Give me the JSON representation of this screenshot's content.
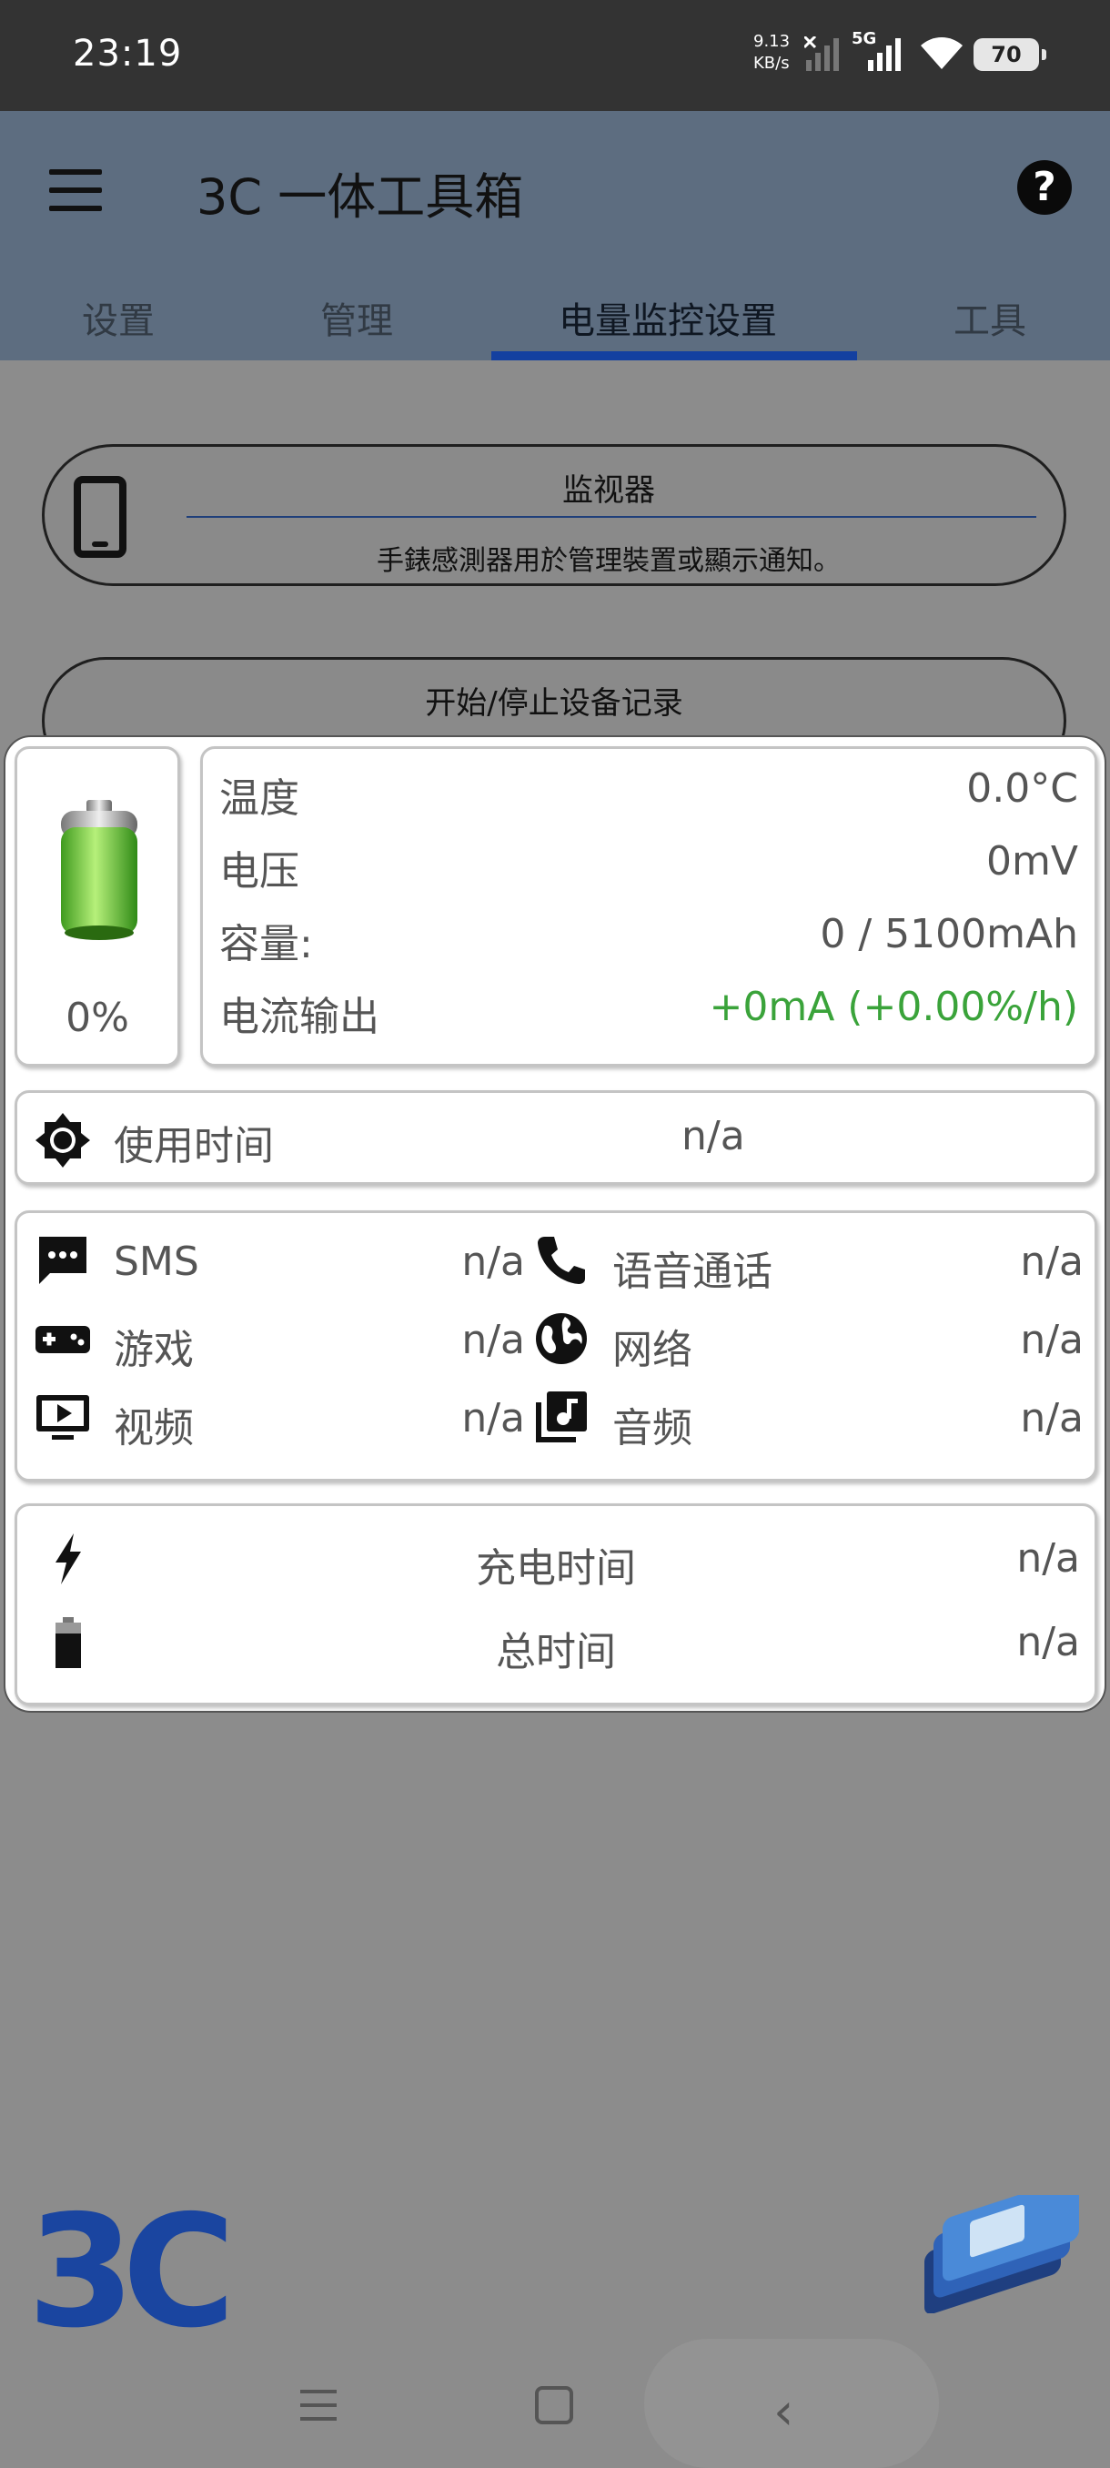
{
  "status_bar": {
    "time": "23:19",
    "net_speed_value": "9.13",
    "net_speed_unit": "KB/s",
    "network_type": "5G",
    "battery_level": "70"
  },
  "app_bar": {
    "title": "3C 一体工具箱",
    "tabs": [
      {
        "label": "设置"
      },
      {
        "label": "管理"
      },
      {
        "label": "电量监控设置",
        "active": true
      },
      {
        "label": "工具"
      }
    ]
  },
  "background": {
    "monitor_card": {
      "title": "监视器",
      "subtitle": "手錶感測器用於管理裝置或顯示通知。"
    },
    "record_card": {
      "title": "开始/停止设备记录"
    },
    "logo_text": "3C"
  },
  "battery_panel": {
    "battery_percent": "0%",
    "info": {
      "temperature_label": "温度",
      "temperature_value": "0.0°C",
      "voltage_label": "电压",
      "voltage_value": "0mV",
      "capacity_label": "容量:",
      "capacity_value": "0 / 5100mAh",
      "current_label": "电流输出",
      "current_value": "+0mA (+0.00%/h)"
    },
    "usage": {
      "label": "使用时间",
      "value": "n/a"
    },
    "apps": [
      {
        "label": "SMS",
        "value": "n/a",
        "icon": "sms-icon"
      },
      {
        "label": "语音通话",
        "value": "n/a",
        "icon": "phone-call-icon"
      },
      {
        "label": "游戏",
        "value": "n/a",
        "icon": "gamepad-icon"
      },
      {
        "label": "网络",
        "value": "n/a",
        "icon": "globe-icon"
      },
      {
        "label": "视频",
        "value": "n/a",
        "icon": "video-icon"
      },
      {
        "label": "音频",
        "value": "n/a",
        "icon": "music-library-icon"
      }
    ],
    "charge": {
      "charge_time_label": "充电时间",
      "charge_time_value": "n/a",
      "total_time_label": "总时间",
      "total_time_value": "n/a"
    }
  },
  "colors": {
    "accent": "#1440a0",
    "positive": "#3aa33a",
    "app_bar": "#5d6d80",
    "status_bar": "#333333"
  }
}
